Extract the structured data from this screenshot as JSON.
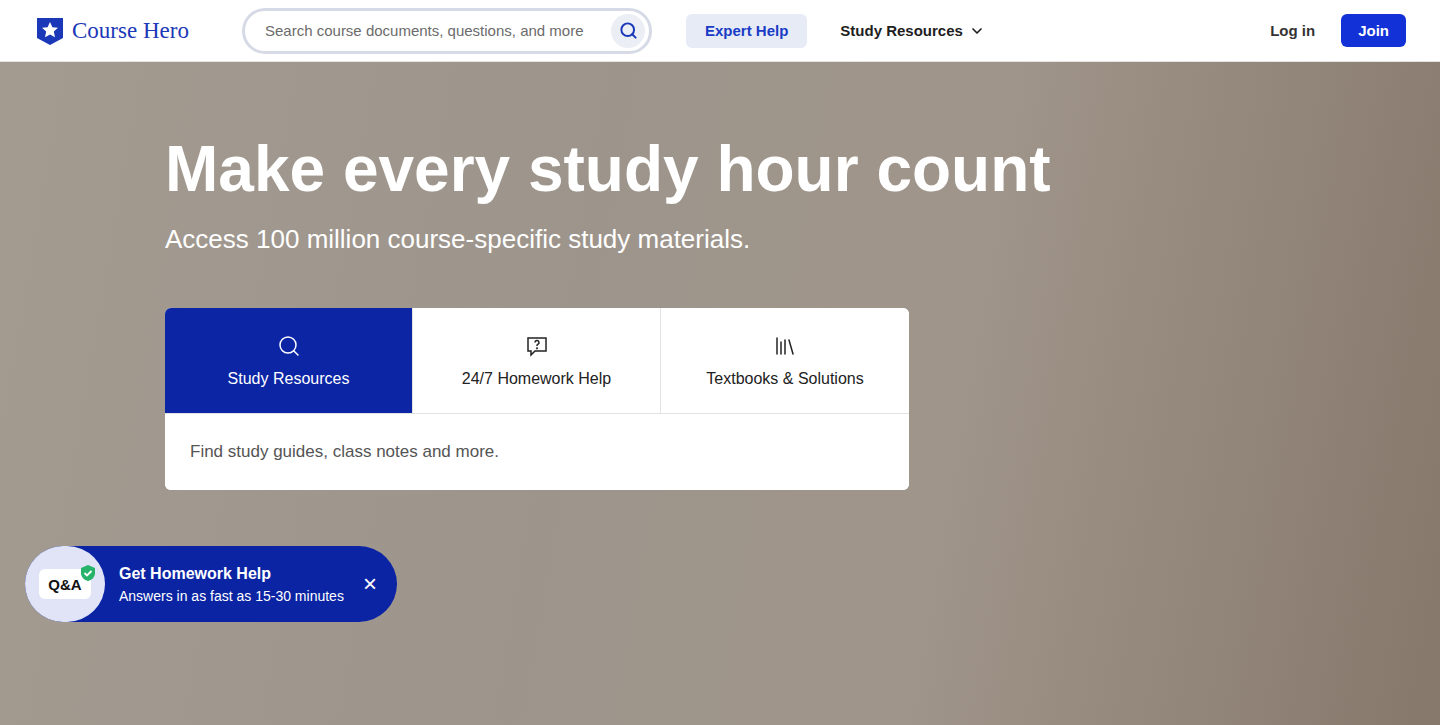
{
  "header": {
    "logo": "Course Hero",
    "search": {
      "placeholder": "Search course documents, questions, and more"
    },
    "nav": [
      {
        "label": "Expert Help",
        "kind": "pill"
      },
      {
        "label": "Study Resources",
        "kind": "dropdown"
      }
    ],
    "login": "Log in",
    "join": "Join"
  },
  "hero": {
    "title": "Make every study hour count",
    "subtitle": "Access 100 million course-specific study materials."
  },
  "tabs": [
    {
      "label": "Study Resources",
      "selected": true
    },
    {
      "label": "24/7 Homework Help",
      "selected": false
    },
    {
      "label": "Textbooks & Solutions",
      "selected": false
    }
  ],
  "tab_panel": {
    "placeholder": "Find study guides, class notes and more."
  },
  "help_widget": {
    "badge": "Q&A",
    "title": "Get Homework Help",
    "subtitle": "Answers in as fast as 15-30 minutes",
    "close": "×"
  }
}
